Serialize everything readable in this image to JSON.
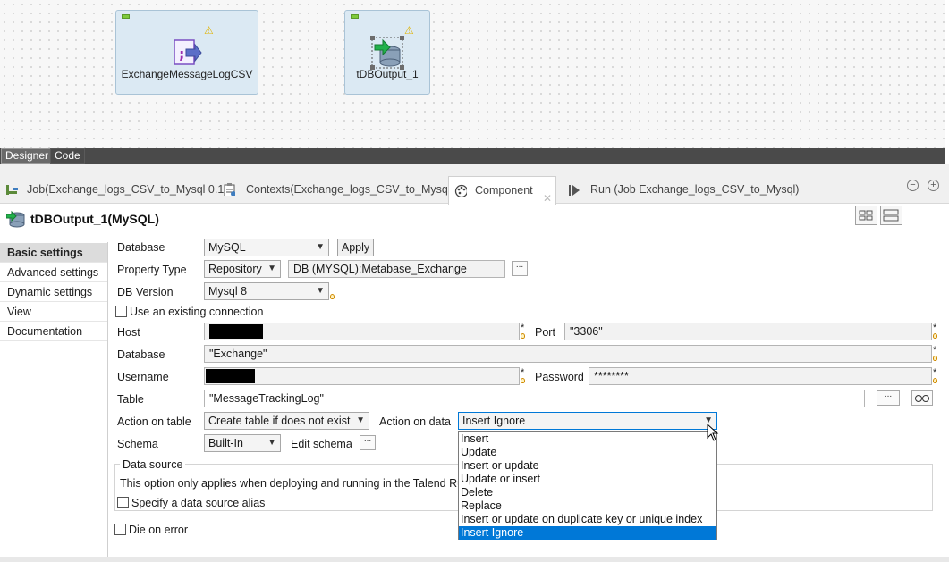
{
  "designer": {
    "nodes": [
      {
        "label": "ExchangeMessageLogCSV"
      },
      {
        "label": "tDBOutput_1"
      }
    ],
    "tabs": {
      "designer": "Designer",
      "code": "Code"
    }
  },
  "view_tabs": {
    "job": "Job(Exchange_logs_CSV_to_Mysql 0.1)",
    "contexts": "Contexts(Exchange_logs_CSV_to_Mysql)",
    "component": "Component",
    "component_close": "✕",
    "run": "Run (Job Exchange_logs_CSV_to_Mysql)",
    "minimize": "−",
    "maximize": "+"
  },
  "component": {
    "title": "tDBOutput_1(MySQL)"
  },
  "left_nav": [
    "Basic settings",
    "Advanced settings",
    "Dynamic settings",
    "View",
    "Documentation"
  ],
  "form": {
    "database_label": "Database",
    "database_value": "MySQL",
    "apply_label": "Apply",
    "property_type_label": "Property Type",
    "property_type_value": "Repository",
    "repository_value": "DB (MYSQL):Metabase_Exchange",
    "db_version_label": "DB Version",
    "db_version_value": "Mysql 8",
    "use_existing_label": "Use an existing connection",
    "host_label": "Host",
    "port_label": "Port",
    "port_value": "\"3306\"",
    "database2_label": "Database",
    "database2_value": "\"Exchange\"",
    "username_label": "Username",
    "password_label": "Password",
    "password_value": "********",
    "table_label": "Table",
    "table_value": "\"MessageTrackingLog\"",
    "action_table_label": "Action on table",
    "action_table_value": "Create table if does not exist",
    "action_data_label": "Action on data",
    "action_data_value": "Insert Ignore",
    "schema_label": "Schema",
    "schema_value": "Built-In",
    "edit_schema_label": "Edit schema",
    "datasource_legend": "Data source",
    "datasource_text": "This option only applies when deploying and running in the Talend Runt",
    "specify_alias_label": "Specify a data source alias",
    "die_on_error_label": "Die on error",
    "required_mark": "*",
    "ellipsis": "..."
  },
  "action_on_data_options": [
    "Insert",
    "Update",
    "Insert or update",
    "Update or insert",
    "Delete",
    "Replace",
    "Insert or update on duplicate key or unique index",
    "Insert Ignore"
  ],
  "colors": {
    "selection": "#0078d7",
    "node_bg": "#dbe9f3",
    "warning": "#e0b300"
  }
}
